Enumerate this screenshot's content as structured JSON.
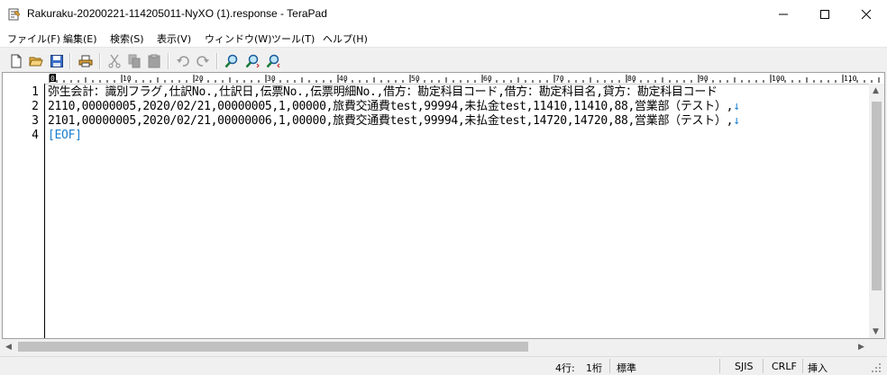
{
  "window": {
    "title": "Rakuraku-20200221-114205011-NyXO (1).response - TeraPad",
    "minimize_icon": "minimize-icon",
    "maximize_icon": "maximize-icon",
    "close_icon": "close-icon"
  },
  "menu": {
    "items": [
      "ファイル(F)",
      "編集(E)",
      "検索(S)",
      "表示(V)",
      "ウィンドウ(W)",
      "ツール(T)",
      "ヘルプ(H)"
    ]
  },
  "toolbar": {
    "icons": [
      "new-file-icon",
      "open-folder-icon",
      "save-icon",
      "print-icon",
      "cut-icon",
      "copy-icon",
      "paste-icon",
      "undo-icon",
      "redo-icon",
      "find-icon",
      "find-next-icon",
      "find-prev-icon"
    ]
  },
  "ruler": {
    "labels": [
      "0",
      "10",
      "20",
      "30",
      "40",
      "50",
      "60",
      "70",
      "80",
      "90",
      "100",
      "110"
    ]
  },
  "editor": {
    "line_numbers": [
      "1",
      "2",
      "3",
      "4"
    ],
    "lines": [
      "弥生会計：識別フラグ,仕訳No.,仕訳日,伝票No.,伝票明細No.,借方：勘定科目コード,借方：勘定科目名,貸方：勘定科目コード",
      "2110,00000005,2020/02/21,00000005,1,00000,旅費交通費test,99994,未払金test,11410,11410,88,営業部（テスト）,",
      "2101,00000005,2020/02/21,00000006,1,00000,旅費交通費test,99994,未払金test,14720,14720,88,営業部（テスト）,"
    ],
    "eol_marker": "↓",
    "eof_marker": "[EOF]"
  },
  "status": {
    "position": "4行:",
    "column": "1桁",
    "mode": "標準",
    "encoding": "SJIS",
    "line_ending": "CRLF",
    "insert_mode": "挿入"
  }
}
